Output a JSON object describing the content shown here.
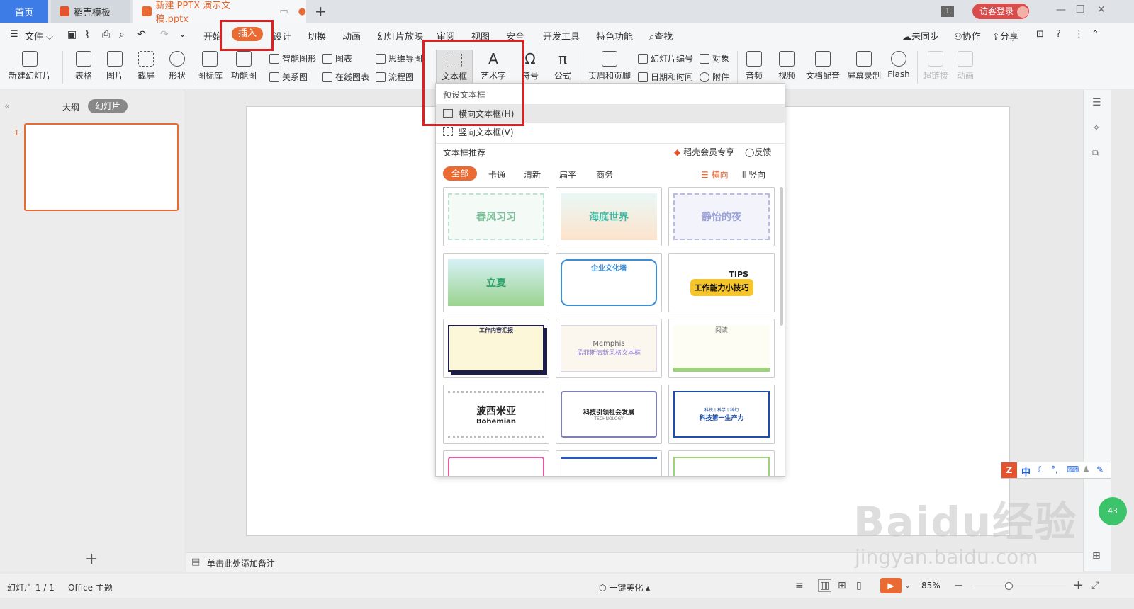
{
  "titlebar": {
    "tabs": [
      {
        "label": "首页"
      },
      {
        "label": "稻壳模板"
      },
      {
        "label": "新建 PPTX 演示文稿.pptx"
      }
    ],
    "badge": "1",
    "login": "访客登录"
  },
  "menu": {
    "file": "文件",
    "items": [
      "开始",
      "插入",
      "设计",
      "切换",
      "动画",
      "幻灯片放映",
      "审阅",
      "视图",
      "安全",
      "开发工具",
      "特色功能"
    ],
    "search": "查找",
    "sync": "未同步",
    "collab": "协作",
    "share": "分享"
  },
  "ribbon": {
    "new_slide": "新建幻灯片",
    "table": "表格",
    "picture": "图片",
    "screenshot": "截屏",
    "shape": "形状",
    "icons": "图标库",
    "function_chart": "功能图",
    "smart_shape": "智能图形",
    "chart": "图表",
    "mind_map": "思维导图",
    "relation": "关系图",
    "online_chart": "在线图表",
    "flowchart": "流程图",
    "textbox": "文本框",
    "wordart": "艺术字",
    "symbol": "符号",
    "formula": "公式",
    "header_footer": "页眉和页脚",
    "slide_number": "幻灯片编号",
    "object": "对象",
    "datetime": "日期和时间",
    "attachment": "附件",
    "audio": "音频",
    "video": "视频",
    "dubbing": "文档配音",
    "screen_record": "屏幕录制",
    "flash": "Flash",
    "hyperlink": "超链接",
    "animation": "动画"
  },
  "leftpanel": {
    "outline": "大纲",
    "slides": "幻灯片",
    "slide_number": "1"
  },
  "notes": "单击此处添加备注",
  "status": {
    "slide_count": "幻灯片 1 / 1",
    "theme": "Office 主题",
    "beautify": "一键美化",
    "zoom": "85%"
  },
  "dropdown": {
    "preset_title": "预设文本框",
    "horizontal": "横向文本框(H)",
    "vertical": "竖向文本框(V)",
    "recommend_title": "文本框推荐",
    "member": "稻壳会员专享",
    "feedback": "反馈",
    "filters": [
      "全部",
      "卡通",
      "清新",
      "扁平",
      "商务"
    ],
    "orient_h": "横向",
    "orient_v": "竖向",
    "cards": [
      {
        "text": "春风习习"
      },
      {
        "text": "海底世界"
      },
      {
        "text": "静怡的夜"
      },
      {
        "text": "立夏"
      },
      {
        "text": "企业文化墙"
      },
      {
        "text": "工作能力小技巧"
      },
      {
        "text": "工作内容汇报"
      },
      {
        "text": "Memphis"
      },
      {
        "text": "阅读"
      },
      {
        "text": "波西米亚"
      },
      {
        "text": "科技引领社会发展"
      },
      {
        "text": "科技第一生产力"
      }
    ],
    "card_sub": {
      "tips": "TIPS",
      "memphis_sub": "孟菲斯清新风格文本框",
      "bohemian_en": "Bohemian",
      "tech_en": "TECHNOLOGY",
      "tech2_top": "科技丨科学丨科幻"
    }
  },
  "ime": {
    "lang": "中"
  },
  "watermark": {
    "brand": "Baidu经验",
    "url": "jingyan.baidu.com"
  },
  "colors": {
    "accent": "#e96a32",
    "blue": "#3d7be7",
    "red_annotation": "#e02020"
  }
}
